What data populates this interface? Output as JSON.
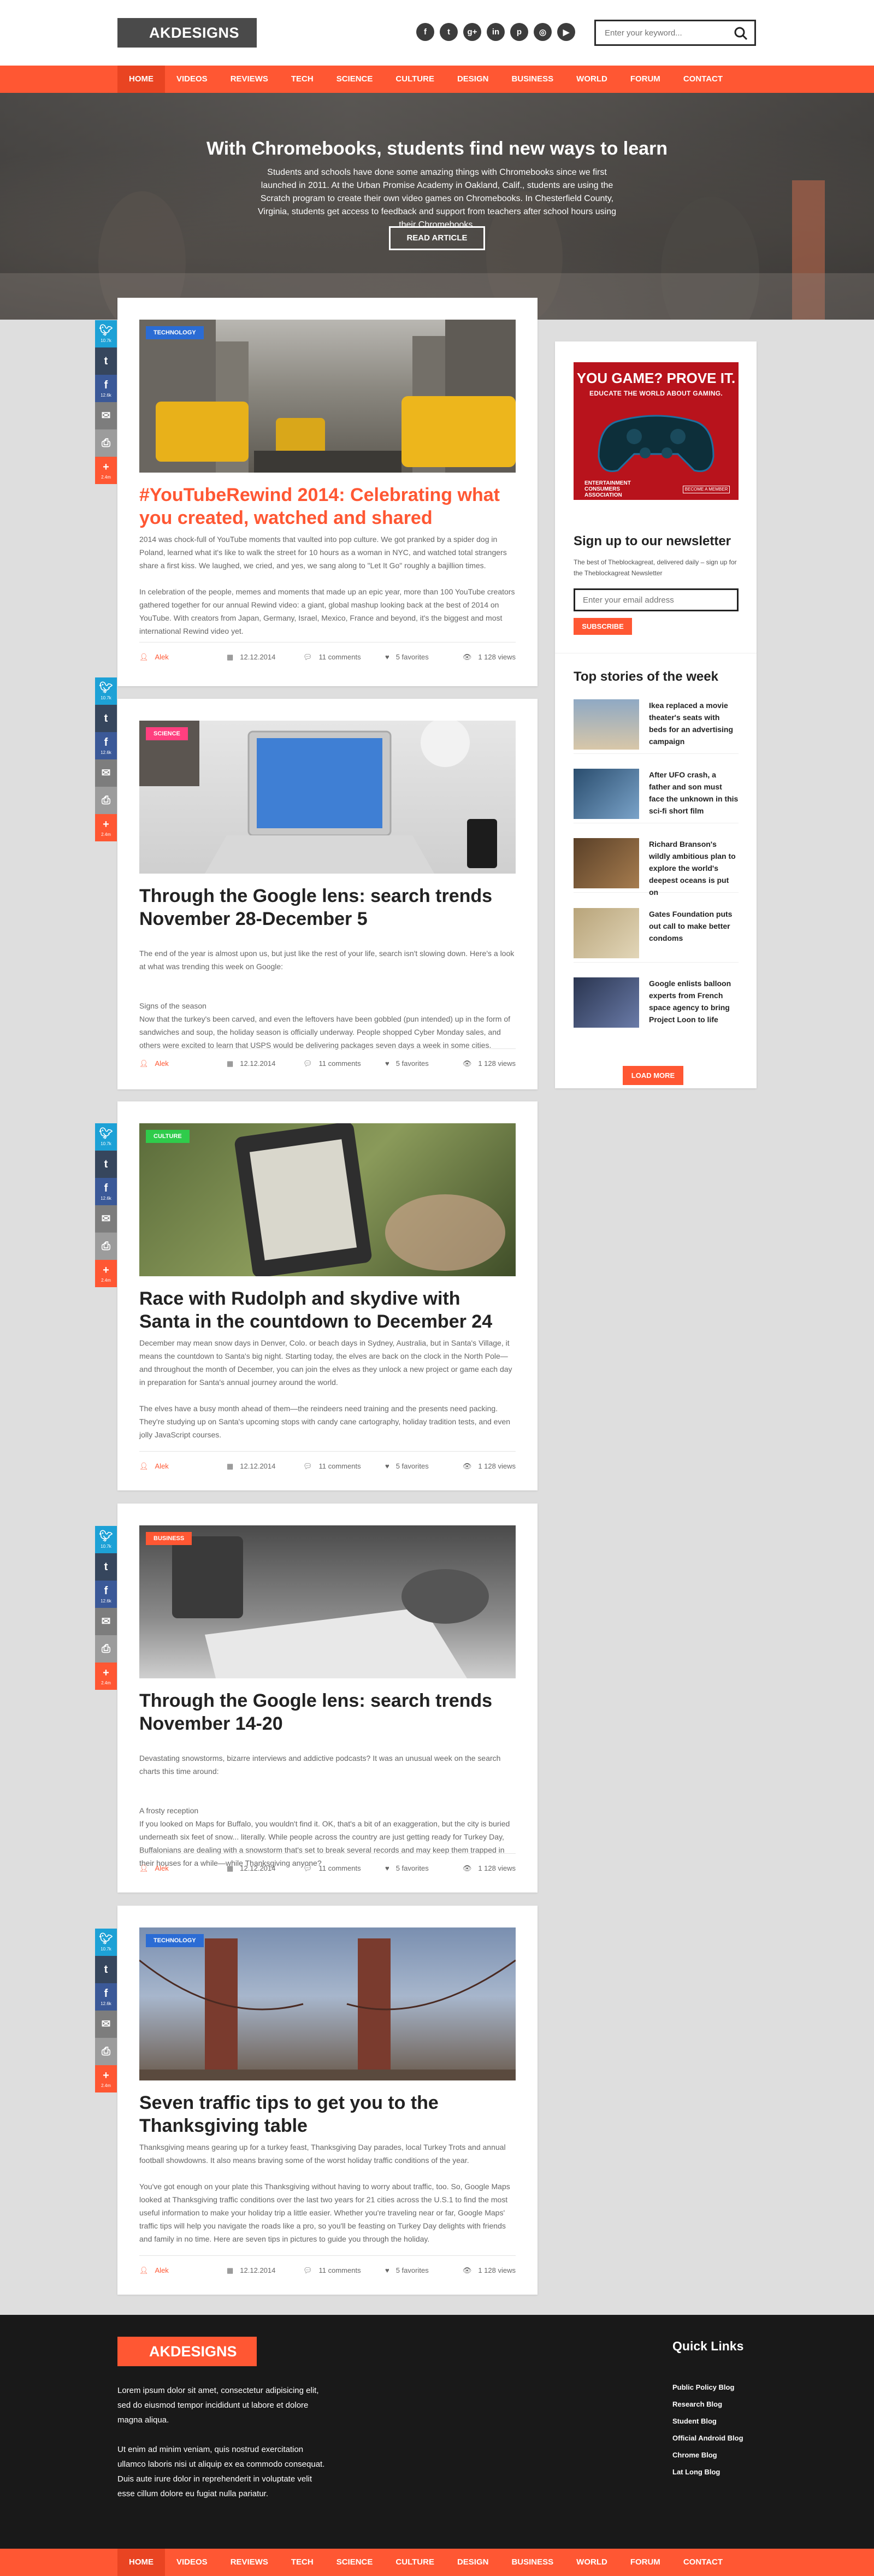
{
  "header": {
    "logo": "AKDESIGNS",
    "search_placeholder": "Enter your keyword...",
    "social_icons": [
      "facebook-icon",
      "twitter-icon",
      "google-plus-icon",
      "linkedin-icon",
      "pinterest-icon",
      "dribbble-icon",
      "youtube-icon"
    ]
  },
  "nav": {
    "items": [
      "HOME",
      "VIDEOS",
      "REVIEWS",
      "TECH",
      "SCIENCE",
      "CULTURE",
      "DESIGN",
      "BUSINESS",
      "WORLD",
      "FORUM",
      "CONTACT"
    ],
    "active": "HOME"
  },
  "hero": {
    "title": "With Chromebooks, students find new ways to learn",
    "text": "Students and schools have done some amazing things with Chromebooks since we first launched in 2011. At the Urban Promise Academy in Oakland, Calif., students are using the Scratch program to create their own video games on Chromebooks. In Chesterfield County, Virginia, students get access to feedback and support from teachers after school hours using their Chromebooks.",
    "button": "READ ARTICLE"
  },
  "share": {
    "counts": [
      "10.7k",
      "2.4k",
      "12.6k",
      "2.4m"
    ]
  },
  "posts": [
    {
      "category": "TECHNOLOGY",
      "title": "#YouTubeRewind 2014: Celebrating what you created, watched and shared",
      "paragraphs": [
        "2014 was chock-full of YouTube moments that vaulted into pop culture. We got pranked by a spider dog in Poland, learned what it's like to walk the street for 10 hours as a woman in NYC, and watched total strangers share a first kiss. We laughed, we cried, and yes, we sang along to \"Let It Go\" roughly a bajillion times.",
        "In celebration of the people, memes and moments that made up an epic year, more than 100 YouTube creators gathered together for our annual Rewind video: a giant, global mashup looking back at the best of 2014 on YouTube. With creators from Japan, Germany, Israel, Mexico, France and beyond, it's the biggest and most international Rewind video yet."
      ],
      "author": "Alek",
      "date": "12.12.2014",
      "comments": "11 comments",
      "favorites": "5 favorites",
      "views": "1 128 views"
    },
    {
      "category": "SCIENCE",
      "title": "Through the Google lens: search trends November 28-December 5",
      "paragraphs": [
        "The end of the year is almost upon us, but just like the rest of your life, search isn't slowing down. Here's a look at what was trending this week on Google:",
        "Signs of the season\nNow that the turkey's been carved, and even the leftovers have been gobbled (pun intended) up in the form of sandwiches and soup, the holiday season is officially underway. People shopped Cyber Monday sales, and others were excited to learn that USPS would be delivering packages seven days a week in some cities."
      ],
      "author": "Alek",
      "date": "12.12.2014",
      "comments": "11 comments",
      "favorites": "5 favorites",
      "views": "1 128 views"
    },
    {
      "category": "CULTURE",
      "title": "Race with Rudolph and skydive with Santa in the countdown to December 24",
      "paragraphs": [
        "December may mean snow days in Denver, Colo. or beach days in Sydney, Australia, but in Santa's Village, it means the countdown to Santa's big night. Starting today, the elves are back on the clock in the North Pole—and throughout the month of December, you can join the elves as they unlock a new project or game each day in preparation for Santa's annual journey around the world.",
        "The elves have a busy month ahead of them—the reindeers need training and the presents need packing. They're studying up on Santa's upcoming stops with candy cane cartography, holiday tradition tests, and even jolly JavaScript courses."
      ],
      "author": "Alek",
      "date": "12.12.2014",
      "comments": "11 comments",
      "favorites": "5 favorites",
      "views": "1 128 views"
    },
    {
      "category": "BUSINESS",
      "title": "Through the Google lens: search trends November 14-20",
      "paragraphs": [
        "Devastating snowstorms, bizarre interviews and addictive podcasts? It was an unusual week on the search charts this time around:",
        "A frosty reception\nIf you looked on Maps for Buffalo, you wouldn't find it. OK, that's a bit of an exaggeration, but the city is buried underneath six feet of snow... literally. While people across the country are just getting ready for Turkey Day, Buffalonians are dealing with a snowstorm that's set to break several records and may keep them trapped in their houses for a while—while Thanksgiving anyone?"
      ],
      "author": "Alek",
      "date": "12.12.2014",
      "comments": "11 comments",
      "favorites": "5 favorites",
      "views": "1 128 views"
    },
    {
      "category": "TECHNOLOGY",
      "title": "Seven traffic tips to get you to the Thanksgiving table",
      "paragraphs": [
        "Thanksgiving means gearing up for a turkey feast, Thanksgiving Day parades, local Turkey Trots and annual football showdowns. It also means braving some of the worst holiday traffic conditions of the year.",
        "You've got enough on your plate this Thanksgiving without having to worry about traffic, too. So, Google Maps looked at Thanksgiving traffic conditions over the last two years for 21 cities across the U.S.1 to find the most useful information to make your holiday trip a little easier. Whether you're traveling near or far, Google Maps' traffic tips will help you navigate the roads like a pro, so you'll be feasting on Turkey Day delights with friends and family in no time. Here are seven tips in pictures to guide you through the holiday."
      ],
      "author": "Alek",
      "date": "12.12.2014",
      "comments": "11 comments",
      "favorites": "5 favorites",
      "views": "1 128 views"
    }
  ],
  "sidebar": {
    "ad": {
      "headline": "YOU GAME? PROVE IT.",
      "subline": "EDUCATE THE WORLD ABOUT GAMING.",
      "tag": "ENTERTAINMENT\nCONSUMERS\nASSOCIATION",
      "button": "BECOME A MEMBER"
    },
    "newsletter": {
      "title": "Sign up to our newsletter",
      "text": "The best of Theblockagreat, delivered daily – sign up for the Theblockagreat Newsletter",
      "placeholder": "Enter your email address",
      "button": "SUBSCRIBE"
    },
    "top_stories": {
      "title": "Top stories of the week",
      "items": [
        "Ikea replaced a movie theater's seats with beds for an advertising campaign",
        "After UFO crash, a father and son must face the unknown in this sci-fi short film",
        "Richard Branson's wildly ambitious plan to explore the world's deepest oceans is put on",
        "Gates Foundation puts out call to make better condoms",
        "Google enlists balloon experts from French space agency to bring Project Loon to life"
      ],
      "load_more": "LOAD MORE"
    }
  },
  "footer": {
    "logo": "AKDESIGNS",
    "paragraphs": [
      "Lorem ipsum dolor sit amet, consectetur adipisicing elit, sed do eiusmod tempor incididunt ut labore et dolore magna aliqua.",
      "Ut enim ad minim veniam, quis nostrud exercitation ullamco laboris nisi ut aliquip ex ea commodo consequat. Duis aute irure dolor in reprehenderit in voluptate velit esse cillum dolore eu fugiat nulla pariatur."
    ],
    "quick_links_title": "Quick Links",
    "quick_links": [
      "Public Policy Blog",
      "Research Blog",
      "Student Blog",
      "Official Android Blog",
      "Chrome Blog",
      "Lat Long Blog"
    ]
  },
  "colors": {
    "accent": "#ff5733",
    "dark": "#4a4a4a",
    "twitter": "#1da1d6",
    "tumblr": "#36465d",
    "facebook": "#3b5998",
    "email": "#7d7d7d",
    "print": "#9c9c9c",
    "plus": "#ff5733"
  }
}
